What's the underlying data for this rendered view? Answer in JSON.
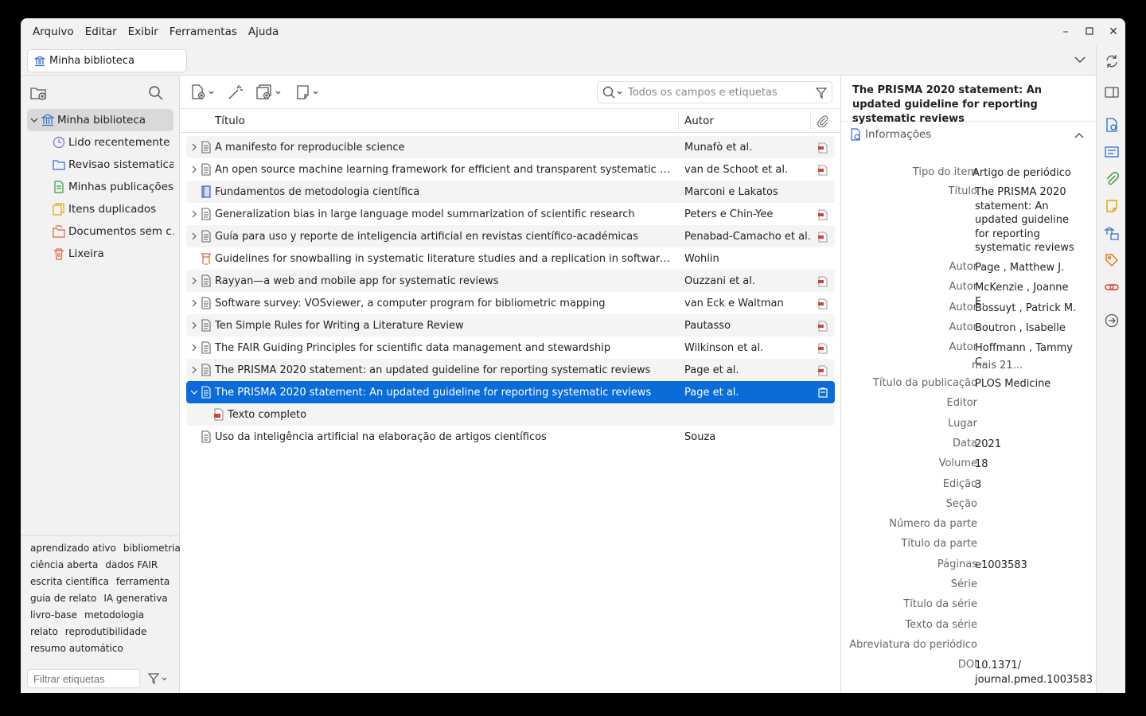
{
  "menu": [
    "Arquivo",
    "Editar",
    "Exibir",
    "Ferramentas",
    "Ajuda"
  ],
  "tab": {
    "label": "Minha biblioteca"
  },
  "collections": [
    {
      "label": "Minha biblioteca",
      "icon": "library-icon",
      "selected": true
    },
    {
      "label": "Lido recentemente",
      "icon": "clock-icon"
    },
    {
      "label": "Revisao sistematica...",
      "icon": "folder-icon"
    },
    {
      "label": "Minhas publicações",
      "icon": "publications-icon"
    },
    {
      "label": "Itens duplicados",
      "icon": "duplicates-icon"
    },
    {
      "label": "Documentos sem c...",
      "icon": "unfiled-icon"
    },
    {
      "label": "Lixeira",
      "icon": "trash-icon"
    }
  ],
  "tags": [
    "aprendizado ativo",
    "bibliometria",
    "ciência aberta",
    "dados FAIR",
    "escrita científica",
    "ferramenta",
    "guia de relato",
    "IA generativa",
    "livro-base",
    "metodologia",
    "relato",
    "reprodutibilidade",
    "resumo automático"
  ],
  "tag_filter_placeholder": "Filtrar etiquetas",
  "search": {
    "placeholder": "Todos os campos e etiquetas"
  },
  "columns": {
    "title": "Título",
    "author": "Autor"
  },
  "items": [
    {
      "title": "A manifesto for reproducible science",
      "author": "Munafò et al.",
      "type": "document",
      "expand": true,
      "pdf": true
    },
    {
      "title": "An open source machine learning framework for efficient and transparent systematic reviews",
      "author": "van de Schoot et al.",
      "type": "document",
      "expand": true,
      "pdf": true
    },
    {
      "title": "Fundamentos de metodologia científica",
      "author": "Marconi e Lakatos",
      "type": "book",
      "expand": false,
      "pdf": false
    },
    {
      "title": "Generalization bias in large language model summarization of scientific research",
      "author": "Peters e Chin-Yee",
      "type": "document",
      "expand": true,
      "pdf": true
    },
    {
      "title": "Guía para uso y reporte de inteligencia artificial en revistas científico-académicas",
      "author": "Penabad-Camacho et al.",
      "type": "document",
      "expand": true,
      "pdf": true
    },
    {
      "title": "Guidelines for snowballing in systematic literature studies and a replication in software engine...",
      "author": "Wohlin",
      "type": "conference",
      "expand": false,
      "pdf": false
    },
    {
      "title": "Rayyan—a web and mobile app for systematic reviews",
      "author": "Ouzzani et al.",
      "type": "document",
      "expand": true,
      "pdf": true
    },
    {
      "title": "Software survey: VOSviewer, a computer program for bibliometric mapping",
      "author": "van Eck e Waltman",
      "type": "document",
      "expand": true,
      "pdf": true
    },
    {
      "title": "Ten Simple Rules for Writing a Literature Review",
      "author": "Pautasso",
      "type": "document",
      "expand": true,
      "pdf": true
    },
    {
      "title": "The FAIR Guiding Principles for scientific data management and stewardship",
      "author": "Wilkinson et al.",
      "type": "document",
      "expand": true,
      "pdf": true
    },
    {
      "title": "The PRISMA 2020 statement: an updated guideline for reporting systematic reviews",
      "author": "Page et al.",
      "type": "document",
      "expand": true,
      "pdf": true
    },
    {
      "title": "The PRISMA 2020 statement: An updated guideline for reporting systematic reviews",
      "author": "Page et al.",
      "type": "document",
      "expand": true,
      "expanded": true,
      "selected": true,
      "pdf": true
    },
    {
      "title": "Texto completo",
      "author": "",
      "type": "pdf-child",
      "child": true
    },
    {
      "title": "Uso da inteligência artificial na elaboração de artigos científicos",
      "author": "Souza",
      "type": "document",
      "expand": false,
      "pdf": false
    }
  ],
  "item_pane": {
    "header": "The PRISMA 2020 statement: An updated guideline for reporting systematic reviews",
    "section": "Informações",
    "fields": [
      {
        "label": "Tipo do item",
        "value": "Artigo de periódico"
      },
      {
        "label": "Título",
        "value": "The PRISMA 2020 statement: An updated guideline for reporting systematic reviews"
      },
      {
        "label": "Autor",
        "value": "Page , Matthew J."
      },
      {
        "label": "Autor",
        "value": "McKenzie , Joanne E."
      },
      {
        "label": "Autor",
        "value": "Bossuyt , Patrick M."
      },
      {
        "label": "Autor",
        "value": "Boutron , Isabelle"
      },
      {
        "label": "Autor",
        "value": "Hoffmann , Tammy C."
      }
    ],
    "more_authors": "mais 21...",
    "fields2": [
      {
        "label": "Título da publicação",
        "value": "PLOS Medicine"
      },
      {
        "label": "Editor",
        "value": ""
      },
      {
        "label": "Lugar",
        "value": ""
      },
      {
        "label": "Data",
        "value": "2021"
      },
      {
        "label": "Volume",
        "value": "18"
      },
      {
        "label": "Edição",
        "value": "3"
      },
      {
        "label": "Seção",
        "value": ""
      },
      {
        "label": "Número da parte",
        "value": ""
      },
      {
        "label": "Título da parte",
        "value": ""
      },
      {
        "label": "Páginas",
        "value": "e1003583"
      },
      {
        "label": "Série",
        "value": ""
      },
      {
        "label": "Título da série",
        "value": ""
      },
      {
        "label": "Texto da série",
        "value": ""
      },
      {
        "label": "Abreviatura do periódico",
        "value": ""
      },
      {
        "label": "DOI",
        "value": "10.1371/ journal.pmed.1003583"
      }
    ]
  }
}
